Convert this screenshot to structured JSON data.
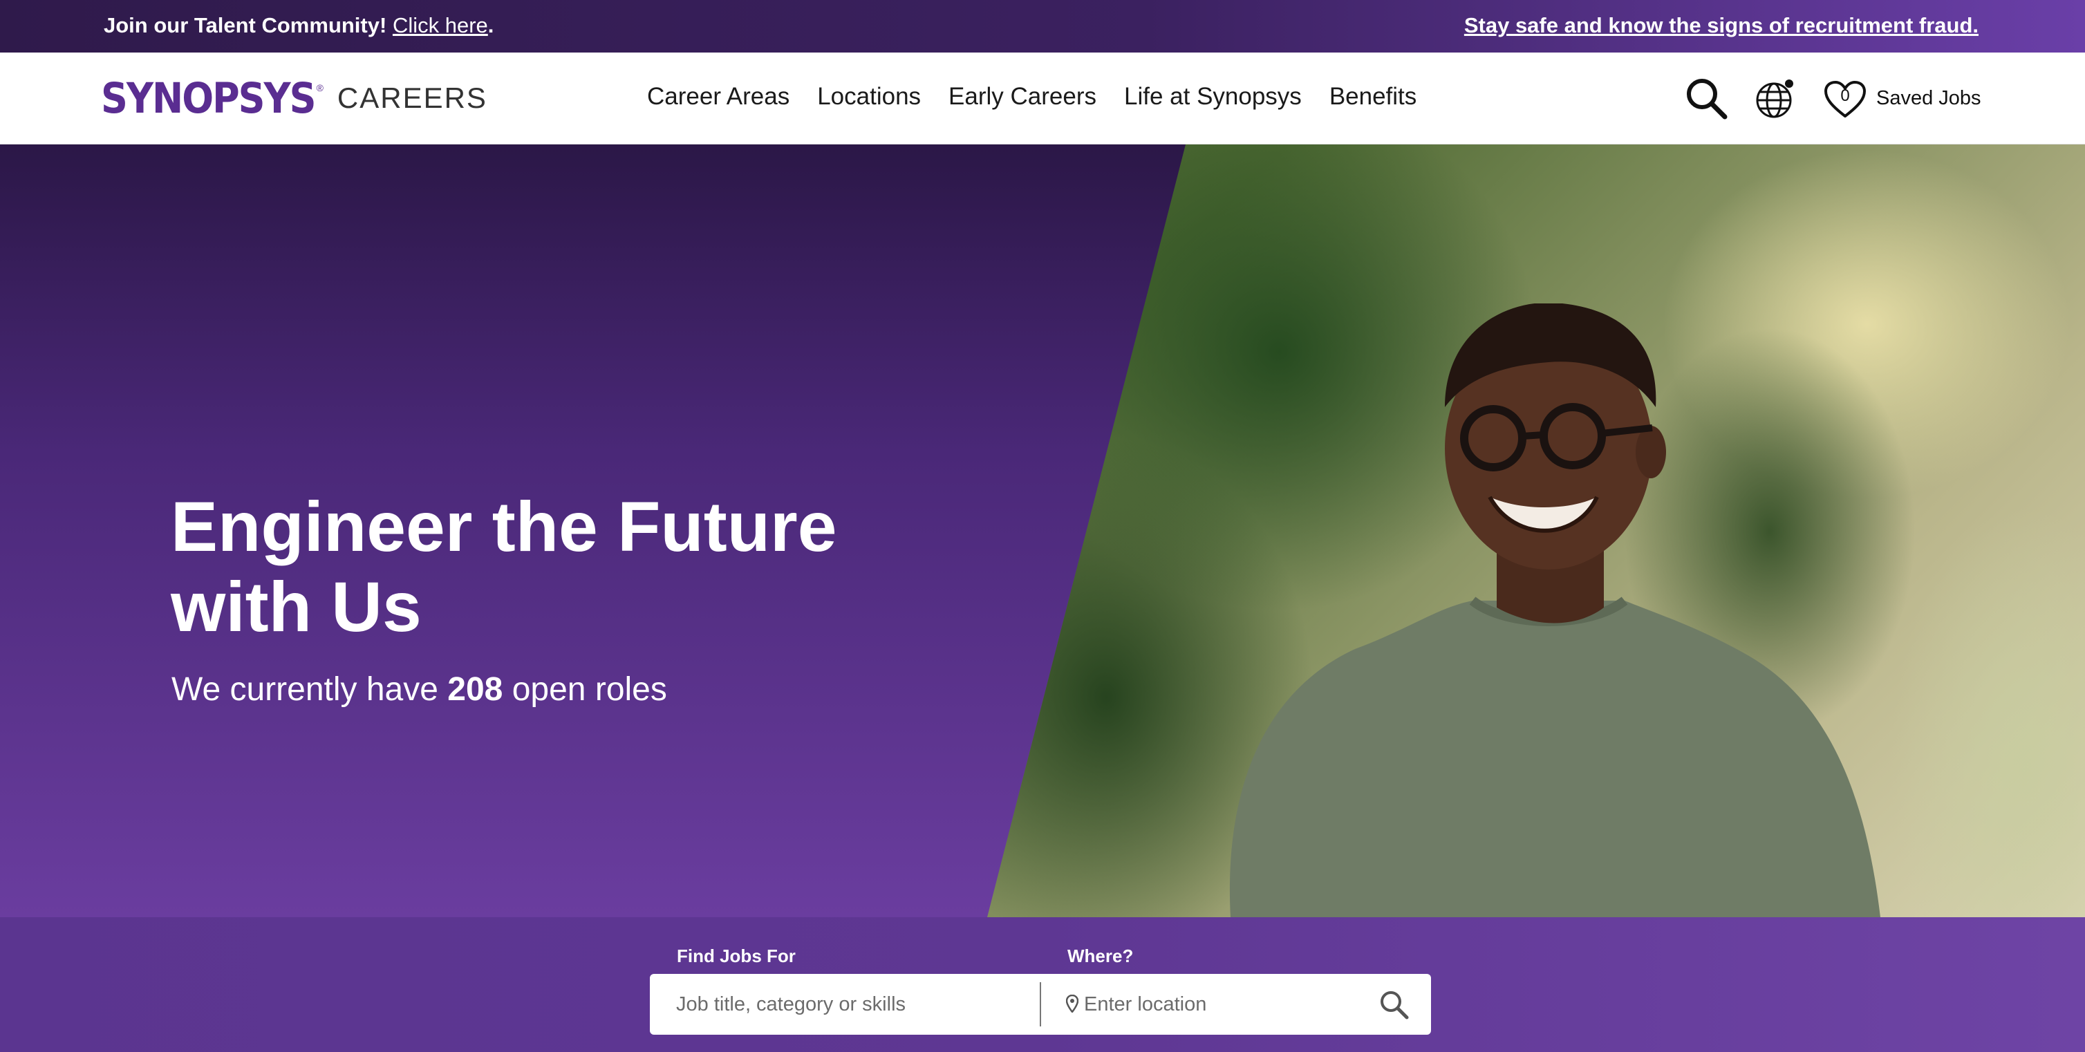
{
  "topbar": {
    "community_prefix": "Join our Talent Community! ",
    "community_link": "Click here",
    "community_suffix": ".",
    "fraud_link": "Stay safe and know the signs of recruitment fraud."
  },
  "header": {
    "logo_brand": "SYNOPSYS",
    "logo_reg": "®",
    "logo_careers": "CAREERS",
    "nav": [
      "Career Areas",
      "Locations",
      "Early Careers",
      "Life at Synopsys",
      "Benefits"
    ],
    "saved_jobs_count": "0",
    "saved_jobs_label": "Saved Jobs",
    "icons": [
      "search-icon",
      "globe-icon",
      "heart-icon"
    ]
  },
  "hero": {
    "title_line1": "Engineer the Future",
    "title_line2": "with Us",
    "sub_prefix": "We currently have ",
    "open_roles": "208",
    "sub_suffix": " open roles"
  },
  "search": {
    "jobs_label": "Find Jobs For",
    "jobs_placeholder": "Job title, category or skills",
    "where_label": "Where?",
    "location_placeholder": "Enter location"
  },
  "colors": {
    "brand_purple": "#5a2d91",
    "hero_dark": "#2b1747",
    "hero_light": "#6a3d9f",
    "text_dark": "#1a1a1a"
  }
}
